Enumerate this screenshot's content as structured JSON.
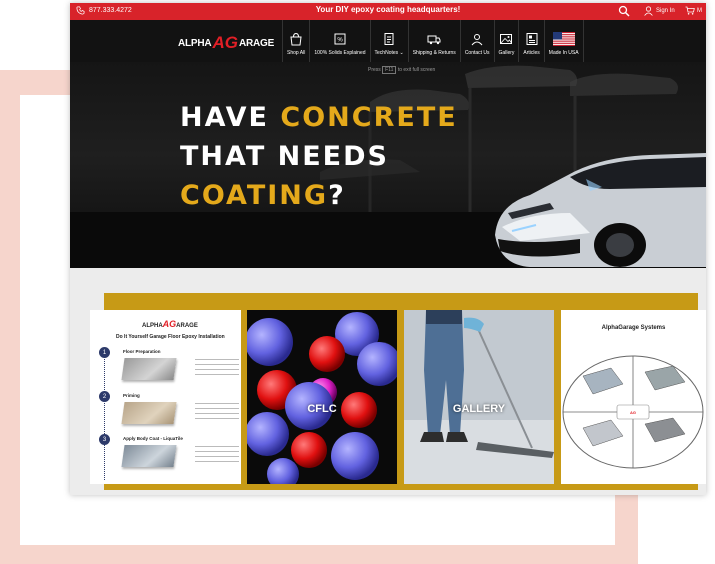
{
  "topbar": {
    "phone": "877.333.4272",
    "tagline": "Your DIY epoxy coating headquarters!",
    "sign_in": "Sign In",
    "cart_label": "M",
    "icons": [
      "phone-icon",
      "search-icon",
      "user-icon",
      "cart-icon"
    ]
  },
  "logo": {
    "pre": "ALPHA",
    "ag": "AG",
    "post": "ARAGE"
  },
  "nav": {
    "items": [
      {
        "label": "Shop All",
        "icon": "shop-icon"
      },
      {
        "label": "100% Solids Explained",
        "icon": "solids-icon"
      },
      {
        "label": "TechNotes ⌄",
        "icon": "technotes-icon"
      },
      {
        "label": "Shipping & Returns",
        "icon": "shipping-icon"
      },
      {
        "label": "Contact Us",
        "icon": "contact-icon"
      },
      {
        "label": "Gallery",
        "icon": "gallery-icon"
      },
      {
        "label": "Articles",
        "icon": "articles-icon"
      },
      {
        "label": "Made In USA",
        "icon": "usa-flag-icon"
      }
    ]
  },
  "hero": {
    "fullscreen_pre": "Press",
    "fullscreen_key": "F11",
    "fullscreen_post": "to exit full screen",
    "line1_a": "HAVE ",
    "line1_b": "CONCRETE",
    "line2": "THAT NEEDS",
    "line3_a": "COATING",
    "line3_b": "?"
  },
  "tiles": {
    "diy": {
      "logo_pre": "ALPHA",
      "logo_ag": "AG",
      "logo_post": "ARAGE",
      "title": "Do It Yourself Garage Floor Epoxy Installation",
      "steps": [
        {
          "num": "1",
          "title": "Floor Preparation"
        },
        {
          "num": "2",
          "title": "Priming"
        },
        {
          "num": "3",
          "title": "Apply Body Coat - LiquaTile"
        }
      ]
    },
    "cflc": {
      "caption": "CFLC"
    },
    "gallery": {
      "caption": "GALLERY"
    },
    "systems": {
      "title": "AlphaGarage Systems"
    }
  },
  "colors": {
    "brand_red": "#d8232a",
    "gold": "#e4a91b",
    "band_gold": "#c79a16",
    "nav_bg": "#121212"
  }
}
